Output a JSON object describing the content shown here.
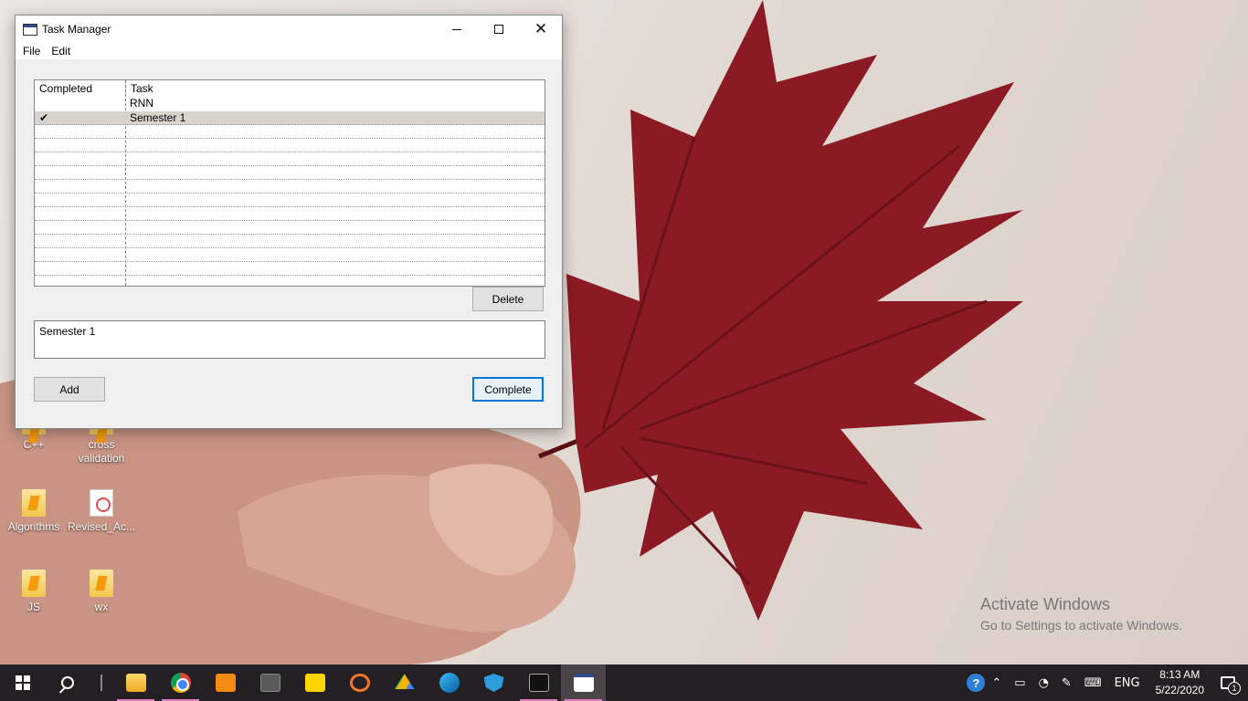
{
  "window": {
    "title": "Task Manager",
    "menu": [
      "File",
      "Edit"
    ]
  },
  "task_list": {
    "headers": {
      "completed": "Completed",
      "task": "Task"
    },
    "rows": [
      {
        "completed": false,
        "completed_mark": "",
        "task": "RNN"
      },
      {
        "completed": true,
        "completed_mark": "✔",
        "task": "Semester 1"
      }
    ],
    "selected_task": "Semester 1"
  },
  "buttons": {
    "delete": "Delete",
    "add": "Add",
    "complete": "Complete"
  },
  "task_input": {
    "value": "Semester 1"
  },
  "desktop": {
    "icons": [
      {
        "label": "C++",
        "icon": "folder-icon"
      },
      {
        "label": "cross validation",
        "icon": "folder-icon"
      },
      {
        "label": "Algorithms",
        "icon": "folder-icon"
      },
      {
        "label": "Revised_Ac...",
        "icon": "pdf-icon"
      },
      {
        "label": "JS",
        "icon": "folder-icon"
      },
      {
        "label": "wx",
        "icon": "folder-icon"
      }
    ],
    "watermark": {
      "line1": "Activate Windows",
      "line2": "Go to Settings to activate Windows."
    }
  },
  "taskbar": {
    "tray": {
      "language": "ENG",
      "time": "8:13 AM",
      "date": "5/22/2020",
      "notification_count": "1"
    }
  },
  "colors": {
    "taskbar": "#241f22",
    "focus_border": "#0078d7",
    "selected_row": "#d8d4cd",
    "leaf": "#8b1a24"
  }
}
